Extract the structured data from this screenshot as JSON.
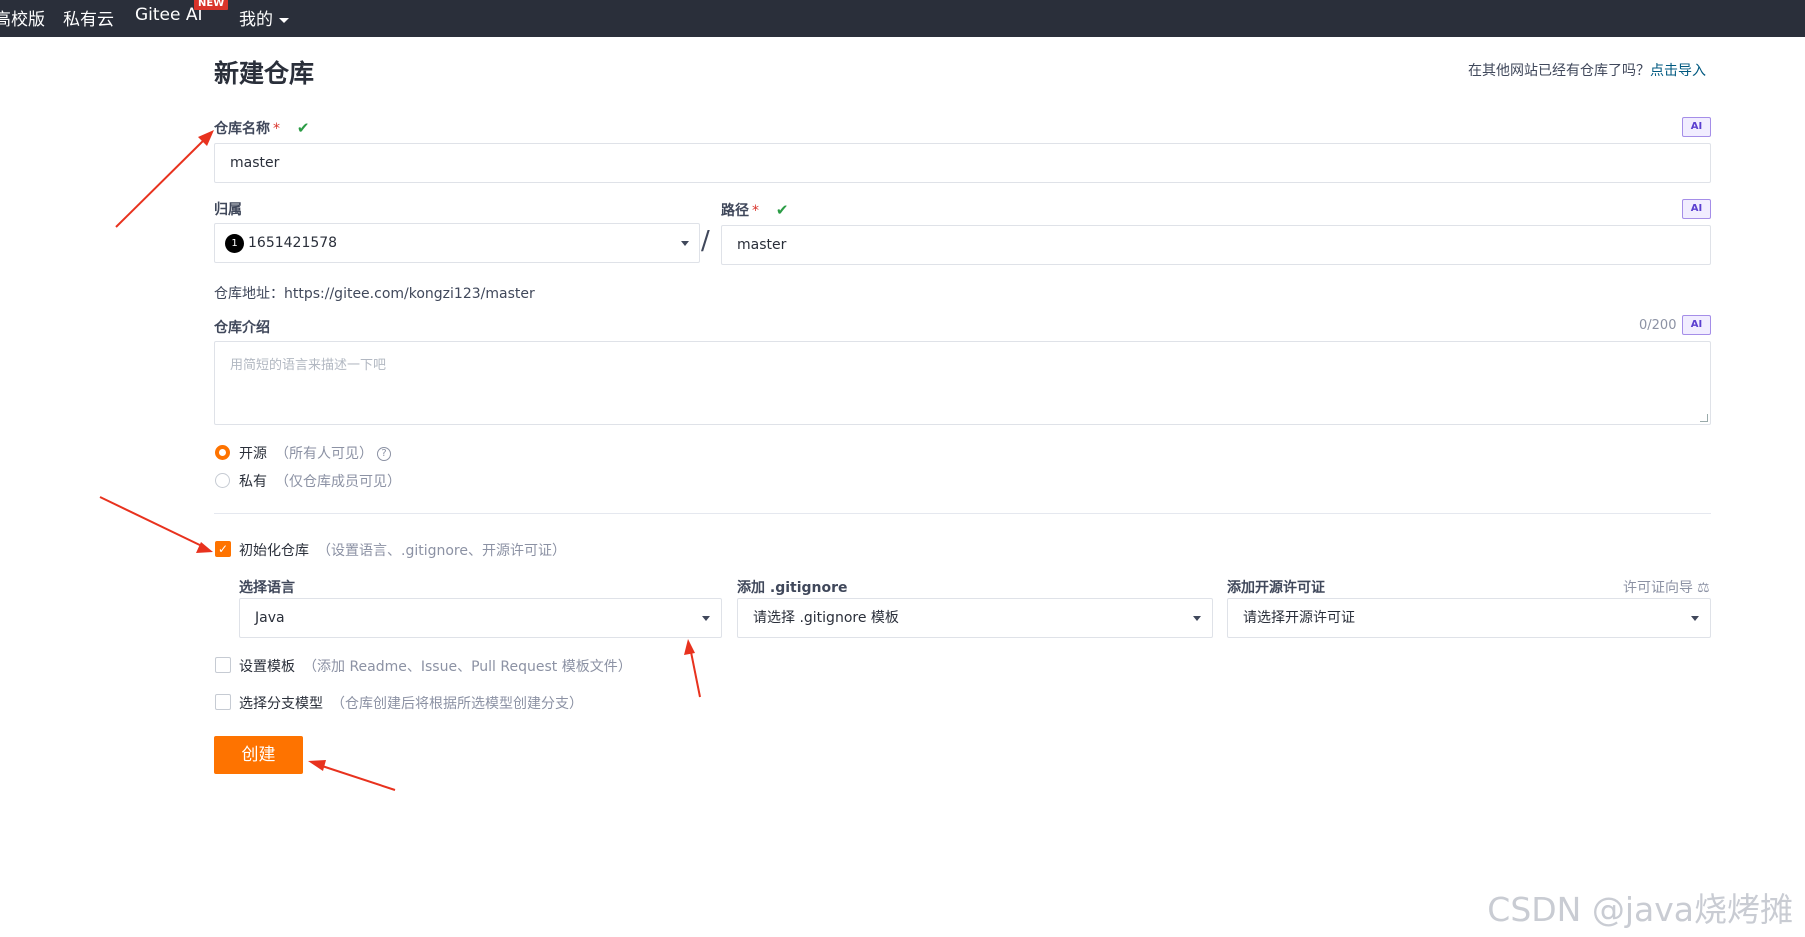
{
  "nav": {
    "items": [
      "高校版",
      "私有云",
      "Gitee AI",
      "我的"
    ],
    "new_badge": "NEW"
  },
  "page": {
    "title": "新建仓库",
    "import_question": "在其他网站已经有仓库了吗？",
    "import_link": "点击导入"
  },
  "form": {
    "ai_label": "AI",
    "repo_name": {
      "label": "仓库名称",
      "required_mark": "*",
      "value": "master"
    },
    "owner": {
      "label": "归属",
      "avatar_text": "1",
      "value": "1651421578"
    },
    "path": {
      "label": "路径",
      "required_mark": "*",
      "value": "master"
    },
    "slash": "/",
    "repo_url": "仓库地址：https://gitee.com/kongzi123/master",
    "description": {
      "label": "仓库介绍",
      "counter": "0/200",
      "placeholder": "用简短的语言来描述一下吧"
    },
    "visibility": {
      "public": {
        "label": "开源",
        "hint": "（所有人可见）",
        "selected": true
      },
      "private": {
        "label": "私有",
        "hint": "（仅仓库成员可见）",
        "selected": false
      }
    },
    "init_repo": {
      "label": "初始化仓库",
      "hint": "（设置语言、.gitignore、开源许可证）",
      "checked": true
    },
    "language": {
      "label": "选择语言",
      "value": "Java"
    },
    "gitignore": {
      "label": "添加 .gitignore",
      "value": "请选择 .gitignore 模板"
    },
    "license": {
      "label": "添加开源许可证",
      "value": "请选择开源许可证",
      "guide": "许可证向导"
    },
    "template": {
      "label": "设置模板",
      "hint": "（添加 Readme、Issue、Pull Request 模板文件）",
      "checked": false
    },
    "branch_model": {
      "label": "选择分支模型",
      "hint": "（仓库创建后将根据所选模型创建分支）",
      "checked": false
    },
    "submit": "创建"
  },
  "watermark": "CSDN @java烧烤摊",
  "colors": {
    "accent": "#fe7300",
    "nav_bg": "#2a2f3a",
    "annotation": "#e8321e",
    "success": "#2b9c45"
  }
}
